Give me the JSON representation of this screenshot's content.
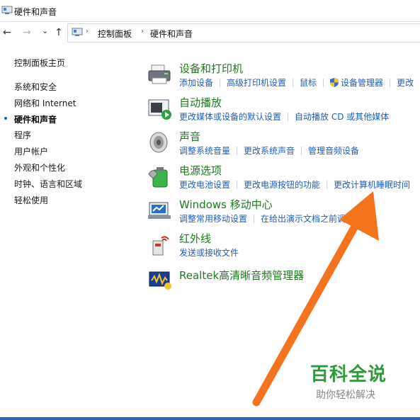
{
  "window": {
    "title": "硬件和声音"
  },
  "nav": {
    "back": "←",
    "forward": "→",
    "dropdown": "⌄",
    "up": "↑",
    "breadcrumb": [
      "控制面板",
      "硬件和声音"
    ],
    "separator": "›"
  },
  "sidebar": {
    "items": [
      {
        "label": "控制面板主页"
      },
      {
        "label": "系统和安全"
      },
      {
        "label": "网络和 Internet"
      },
      {
        "label": "硬件和声音",
        "active": true
      },
      {
        "label": "程序"
      },
      {
        "label": "用户帐户"
      },
      {
        "label": "外观和个性化"
      },
      {
        "label": "时钟、语言和区域"
      },
      {
        "label": "轻松使用"
      }
    ]
  },
  "categories": [
    {
      "title": "设备和打印机",
      "icon": "printer-icon",
      "links": [
        "添加设备",
        "高级打印机设置",
        "鼠标",
        "设备管理器",
        "更改"
      ]
    },
    {
      "title": "自动播放",
      "icon": "autoplay-icon",
      "links": [
        "更改媒体或设备的默认设置",
        "自动播放 CD 或其他媒体"
      ]
    },
    {
      "title": "声音",
      "icon": "speaker-icon",
      "links": [
        "调整系统音量",
        "更改系统声音",
        "管理音频设备"
      ]
    },
    {
      "title": "电源选项",
      "icon": "battery-icon",
      "links": [
        "更改电池设置",
        "更改电源按钮的功能",
        "更改计算机睡眠时间"
      ]
    },
    {
      "title": "Windows 移动中心",
      "icon": "mobility-center-icon",
      "links": [
        "调整常用移动设置",
        "在给出演示文档之前调"
      ]
    },
    {
      "title": "红外线",
      "icon": "infrared-icon",
      "links": [
        "发送或接收文件"
      ]
    },
    {
      "title": "Realtek高清晰音频管理器",
      "icon": "realtek-audio-icon",
      "links": []
    }
  ],
  "watermark": {
    "brand": "百科全说",
    "slogan": "助你轻松解决"
  },
  "colors": {
    "category_title": "#1e7a1e",
    "link": "#1a5fc2",
    "arrow": "#f5731d",
    "watermark": "#2f9a3a"
  }
}
